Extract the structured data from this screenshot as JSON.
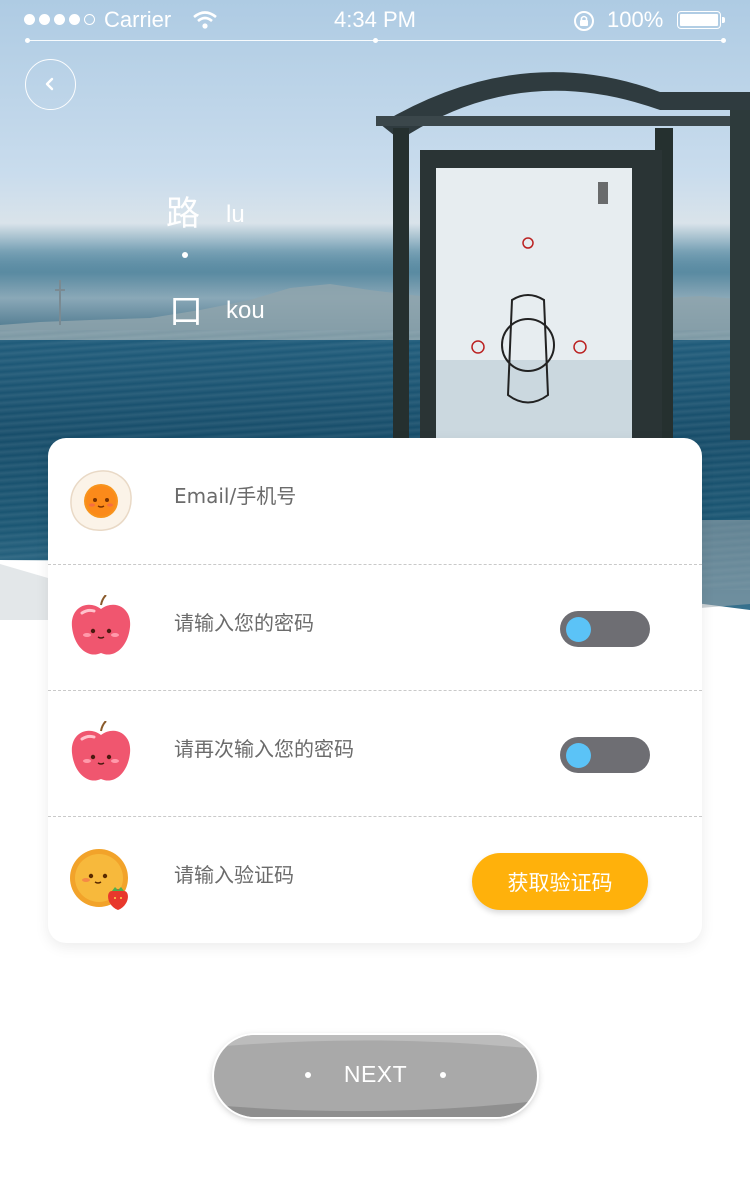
{
  "status_bar": {
    "carrier": "Carrier",
    "time": "4:34 PM",
    "battery": "100%"
  },
  "header": {
    "title_char_1": "路",
    "title_pinyin_1": "lu",
    "title_char_2": "口",
    "title_pinyin_2": "kou"
  },
  "form": {
    "email_placeholder": "Email/手机号",
    "password_placeholder": "请输入您的密码",
    "confirm_password_placeholder": "请再次输入您的密码",
    "code_placeholder": "请输入验证码",
    "get_code_label": "获取验证码"
  },
  "actions": {
    "next_label": "NEXT"
  },
  "colors": {
    "accent": "#ffb10b",
    "toggle_track": "#6e6e73",
    "toggle_knob": "#5bc3f7",
    "next_button": "#a9a9a9"
  },
  "icons": {
    "back": "chevron-left-icon",
    "email_avatar": "fried-egg-icon",
    "password_avatar": "apple-icon",
    "code_avatar": "cookie-strawberry-icon"
  }
}
